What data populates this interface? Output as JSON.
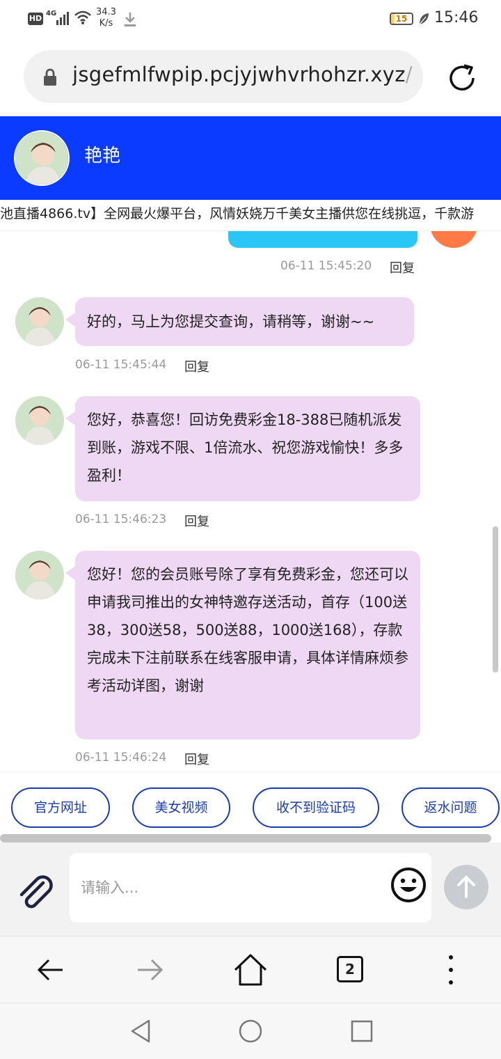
{
  "status_bar": {
    "hd": "HD",
    "network": "4G",
    "speed_value": "34.3",
    "speed_unit": "K/s",
    "battery": "15",
    "time": "15:46"
  },
  "browser": {
    "url_main": "jsgefmlfwpip.pcjyjwhvrhohzr.xyz",
    "url_fade": "/i",
    "tabs_count": "2"
  },
  "chat_header": {
    "name": "艳艳"
  },
  "marquee": {
    "text": "池直播4866.tv】全网最火爆平台，风情妖娆万千美女主播供您在线挑逗，千款游"
  },
  "chat": {
    "sent_timestamp": "06-11 15:45:20",
    "reply_label": "回复",
    "messages": [
      {
        "text": "好的，马上为您提交查询，请稍等，谢谢~~",
        "timestamp": "06-11 15:45:44"
      },
      {
        "text": "您好，恭喜您！回访免费彩金18-388已随机派发到账，游戏不限、1倍流水、祝您游戏愉快！多多盈利！",
        "timestamp": "06-11 15:46:23"
      },
      {
        "text": "您好！您的会员账号除了享有免费彩金，您还可以申请我司推出的女神特邀存送活动，首存（100送38，300送58，500送88，1000送168），存款完成未下注前联系在线客服申请，具体详情麻烦参考活动详图，谢谢",
        "timestamp": "06-11 15:46:24"
      }
    ]
  },
  "quick_replies": [
    "官方网址",
    "美女视频",
    "收不到验证码",
    "返水问题"
  ],
  "input": {
    "placeholder": "请输入..."
  },
  "colors": {
    "header_bg": "#0a3bff",
    "agent_bubble": "#efd8f4",
    "sent_bubble": "#2ac7f5",
    "quick_reply_border": "#1a3cb3"
  },
  "icons": [
    "lock-icon",
    "reload-icon",
    "paperclip-icon",
    "emoji-icon",
    "send-arrow-icon",
    "back-icon",
    "forward-icon",
    "home-icon",
    "tabs-icon",
    "more-icon"
  ]
}
